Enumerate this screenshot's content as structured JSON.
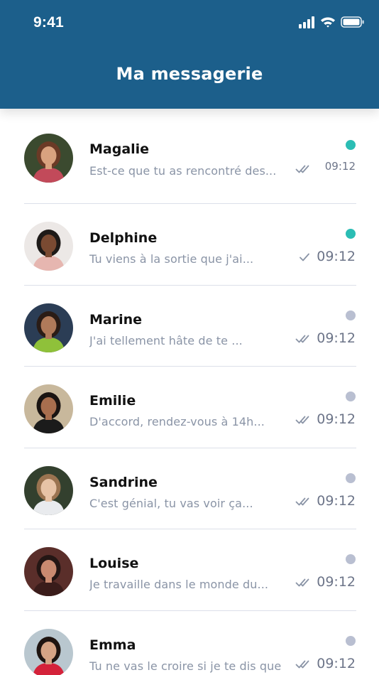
{
  "status_bar": {
    "time": "9:41"
  },
  "header": {
    "title": "Ma messagerie"
  },
  "conversations": [
    {
      "name": "Magalie",
      "preview": "Est-ce que tu as rencontré des...",
      "time": "09:12",
      "online": true,
      "read_status": "double-check-icon",
      "avatar": {
        "bg": "#3b4a2f",
        "skin": "#d9a27f",
        "hair": "#6b3a26",
        "shirt": "#c24a5a"
      }
    },
    {
      "name": "Delphine",
      "preview": "Tu viens à la sortie que j'ai...",
      "time": "09:12",
      "online": true,
      "read_status": "single-check-icon",
      "avatar": {
        "bg": "#ece8e6",
        "skin": "#7a4a32",
        "hair": "#1e1a18",
        "shirt": "#e6b6b0"
      }
    },
    {
      "name": "Marine",
      "preview": "J'ai tellement hâte de te ...",
      "time": "09:12",
      "online": false,
      "read_status": "double-check-icon",
      "avatar": {
        "bg": "#2b3d55",
        "skin": "#b07a5a",
        "hair": "#2a1c16",
        "shirt": "#8fc13a"
      }
    },
    {
      "name": "Emilie",
      "preview": "D'accord, rendez-vous à 14h...",
      "time": "09:12",
      "online": false,
      "read_status": "double-check-icon",
      "avatar": {
        "bg": "#c8b89c",
        "skin": "#a86e4e",
        "hair": "#1a1412",
        "shirt": "#1b1b1b"
      }
    },
    {
      "name": "Sandrine",
      "preview": "C'est génial, tu vas voir ça...",
      "time": "09:12",
      "online": false,
      "read_status": "double-check-icon",
      "avatar": {
        "bg": "#33402e",
        "skin": "#e7c3a6",
        "hair": "#9a7350",
        "shirt": "#e9ebee"
      }
    },
    {
      "name": "Louise",
      "preview": "Je travaille dans le monde du...",
      "time": "09:12",
      "online": false,
      "read_status": "double-check-icon",
      "avatar": {
        "bg": "#5a2e2a",
        "skin": "#c98a70",
        "hair": "#241614",
        "shirt": "#3a1c1a"
      }
    },
    {
      "name": "Emma",
      "preview": "Tu ne vas le croire si je te dis que...",
      "time": "09:12",
      "online": false,
      "read_status": "double-check-icon",
      "avatar": {
        "bg": "#b9c7cf",
        "skin": "#d5a485",
        "hair": "#1e1410",
        "shirt": "#d4223a"
      }
    }
  ],
  "colors": {
    "header_bg": "#1c5f8b",
    "online_dot": "#2bbdb4",
    "offline_dot": "#b9bfd1",
    "divider": "#dcdfe9"
  }
}
